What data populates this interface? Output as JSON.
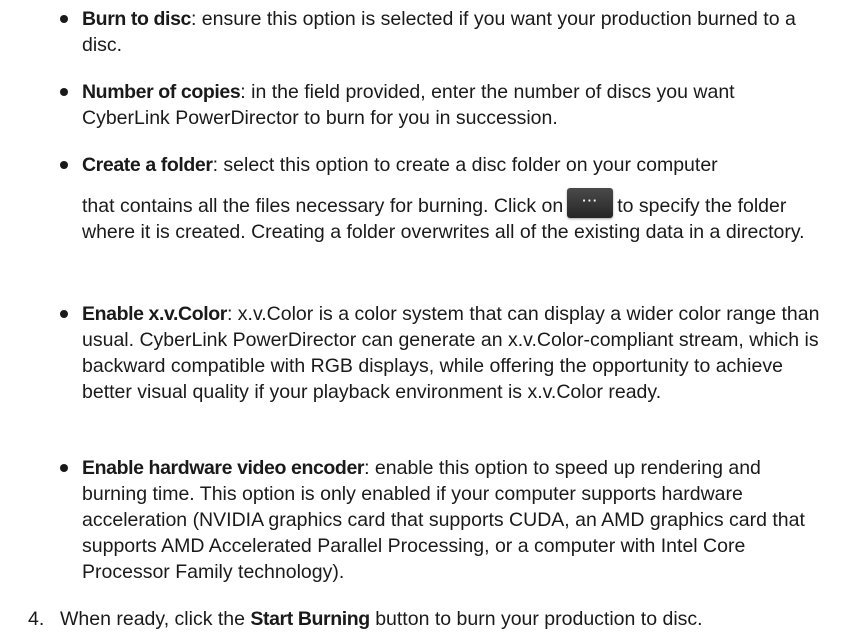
{
  "items": [
    {
      "term": "Burn to disc",
      "text": ": ensure this option is selected if you want your production burned to a disc."
    },
    {
      "term": "Number of copies",
      "text": ": in the field provided, enter the number of discs you want CyberLink PowerDirector to burn for you in succession."
    },
    {
      "term": "Create a folder",
      "text_before": ": select this option to create a disc folder on your computer",
      "text_line2_before": "that contains all the files necessary for burning. Click on",
      "button_glyph": "···",
      "text_after": "to specify the folder where it is created. Creating a folder overwrites all of the existing data in a directory."
    },
    {
      "term": "Enable x.v.Color",
      "text": ": x.v.Color is a color system that can display a wider color range than usual. CyberLink PowerDirector can generate an x.v.Color-compliant stream, which is backward compatible with RGB displays, while offering the opportunity to achieve better visual quality if your playback environment is x.v.Color ready."
    },
    {
      "term": "Enable hardware video encoder",
      "text": ": enable this option to speed up rendering and burning time. This option is only enabled if your computer supports hardware acceleration (NVIDIA graphics card that supports CUDA, an AMD graphics card that supports AMD Accelerated Parallel Processing, or a computer with Intel Core Processor Family technology)."
    }
  ],
  "step": {
    "number": "4.",
    "text_before": "When ready, click the ",
    "term": "Start Burning",
    "text_after": " button to burn your production to disc."
  }
}
